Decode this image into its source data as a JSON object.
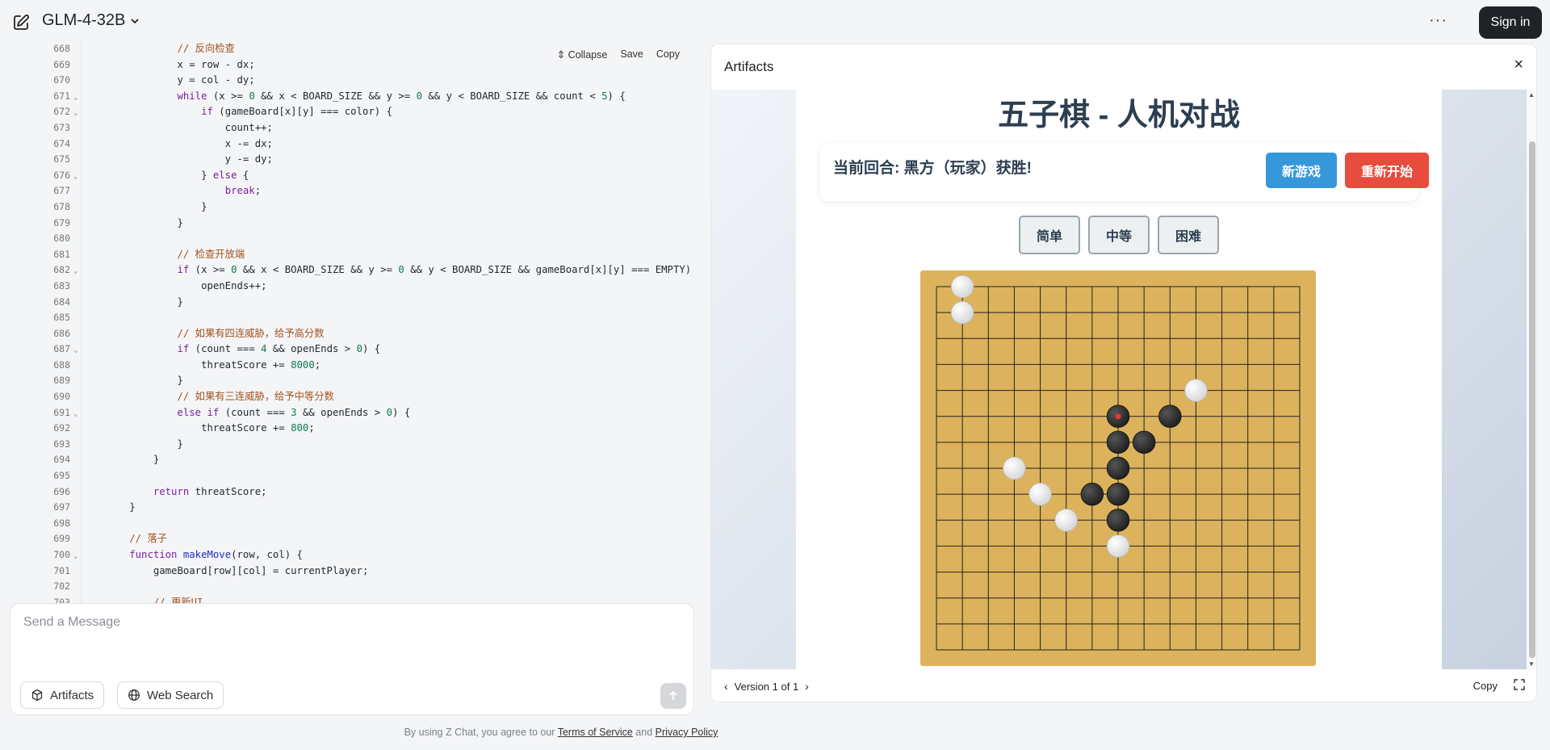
{
  "header": {
    "model_name": "GLM-4-32B",
    "more_label": "···",
    "signin_label": "Sign in"
  },
  "code": {
    "tools": {
      "collapse": "Collapse",
      "save": "Save",
      "copy": "Copy"
    },
    "lines": [
      {
        "n": "668",
        "fold": false,
        "t": "                // 反向检查",
        "hl": "cm"
      },
      {
        "n": "669",
        "fold": false,
        "t": "                x = row - dx;"
      },
      {
        "n": "670",
        "fold": false,
        "t": "                y = col - dy;"
      },
      {
        "n": "671",
        "fold": true,
        "t": "                while (x >= 0 && x < BOARD_SIZE && y >= 0 && y < BOARD_SIZE && count < 5) {"
      },
      {
        "n": "672",
        "fold": true,
        "t": "                    if (gameBoard[x][y] === color) {"
      },
      {
        "n": "673",
        "fold": false,
        "t": "                        count++;"
      },
      {
        "n": "674",
        "fold": false,
        "t": "                        x -= dx;"
      },
      {
        "n": "675",
        "fold": false,
        "t": "                        y -= dy;"
      },
      {
        "n": "676",
        "fold": true,
        "t": "                    } else {"
      },
      {
        "n": "677",
        "fold": false,
        "t": "                        break;"
      },
      {
        "n": "678",
        "fold": false,
        "t": "                    }"
      },
      {
        "n": "679",
        "fold": false,
        "t": "                }"
      },
      {
        "n": "680",
        "fold": false,
        "t": ""
      },
      {
        "n": "681",
        "fold": false,
        "t": "                // 检查开放端",
        "hl": "cm"
      },
      {
        "n": "682",
        "fold": true,
        "t": "                if (x >= 0 && x < BOARD_SIZE && y >= 0 && y < BOARD_SIZE && gameBoard[x][y] === EMPTY)"
      },
      {
        "n": "683",
        "fold": false,
        "t": "                    openEnds++;"
      },
      {
        "n": "684",
        "fold": false,
        "t": "                }"
      },
      {
        "n": "685",
        "fold": false,
        "t": ""
      },
      {
        "n": "686",
        "fold": false,
        "t": "                // 如果有四连威胁，给予高分数",
        "hl": "cm"
      },
      {
        "n": "687",
        "fold": true,
        "t": "                if (count === 4 && openEnds > 0) {"
      },
      {
        "n": "688",
        "fold": false,
        "t": "                    threatScore += 8000;"
      },
      {
        "n": "689",
        "fold": false,
        "t": "                }"
      },
      {
        "n": "690",
        "fold": false,
        "t": "                // 如果有三连威胁，给予中等分数",
        "hl": "cm"
      },
      {
        "n": "691",
        "fold": true,
        "t": "                else if (count === 3 && openEnds > 0) {"
      },
      {
        "n": "692",
        "fold": false,
        "t": "                    threatScore += 800;"
      },
      {
        "n": "693",
        "fold": false,
        "t": "                }"
      },
      {
        "n": "694",
        "fold": false,
        "t": "            }"
      },
      {
        "n": "695",
        "fold": false,
        "t": ""
      },
      {
        "n": "696",
        "fold": false,
        "t": "            return threatScore;"
      },
      {
        "n": "697",
        "fold": false,
        "t": "        }"
      },
      {
        "n": "698",
        "fold": false,
        "t": ""
      },
      {
        "n": "699",
        "fold": false,
        "t": "        // 落子",
        "hl": "cm"
      },
      {
        "n": "700",
        "fold": true,
        "t": "        function makeMove(row, col) {"
      },
      {
        "n": "701",
        "fold": false,
        "t": "            gameBoard[row][col] = currentPlayer;"
      },
      {
        "n": "702",
        "fold": false,
        "t": ""
      },
      {
        "n": "703",
        "fold": false,
        "t": "            // 更新UI",
        "hl": "cm"
      }
    ]
  },
  "composer": {
    "placeholder": "Send a Message",
    "artifacts_label": "Artifacts",
    "websearch_label": "Web Search"
  },
  "footer": {
    "prefix": "By using Z Chat, you agree to our ",
    "terms": "Terms of Service",
    "and": " and ",
    "privacy": "Privacy Policy"
  },
  "artifacts": {
    "title": "Artifacts",
    "close": "×",
    "version": "Version 1 of 1",
    "copy": "Copy"
  },
  "game": {
    "title": "五子棋 - 人机对战",
    "status": "当前回合: 黑方（玩家）获胜!",
    "new_game": "新游戏",
    "restart": "重新开始",
    "difficulty": [
      "简单",
      "中等",
      "困难"
    ],
    "difficulty_active": 2,
    "board_size": 15,
    "colors": {
      "board": "#dcb35c",
      "black": "#222222",
      "white": "#ffffff",
      "last_move": "#e53935"
    },
    "stones": [
      {
        "r": 0,
        "c": 1,
        "color": "white"
      },
      {
        "r": 1,
        "c": 1,
        "color": "white"
      },
      {
        "r": 4,
        "c": 10,
        "color": "white"
      },
      {
        "r": 5,
        "c": 7,
        "color": "black",
        "last": true
      },
      {
        "r": 5,
        "c": 9,
        "color": "black"
      },
      {
        "r": 6,
        "c": 7,
        "color": "black"
      },
      {
        "r": 6,
        "c": 8,
        "color": "black"
      },
      {
        "r": 7,
        "c": 3,
        "color": "white"
      },
      {
        "r": 7,
        "c": 7,
        "color": "black"
      },
      {
        "r": 8,
        "c": 4,
        "color": "white"
      },
      {
        "r": 8,
        "c": 6,
        "color": "black"
      },
      {
        "r": 8,
        "c": 7,
        "color": "black"
      },
      {
        "r": 9,
        "c": 5,
        "color": "white"
      },
      {
        "r": 9,
        "c": 7,
        "color": "black"
      },
      {
        "r": 10,
        "c": 7,
        "color": "white"
      }
    ]
  }
}
